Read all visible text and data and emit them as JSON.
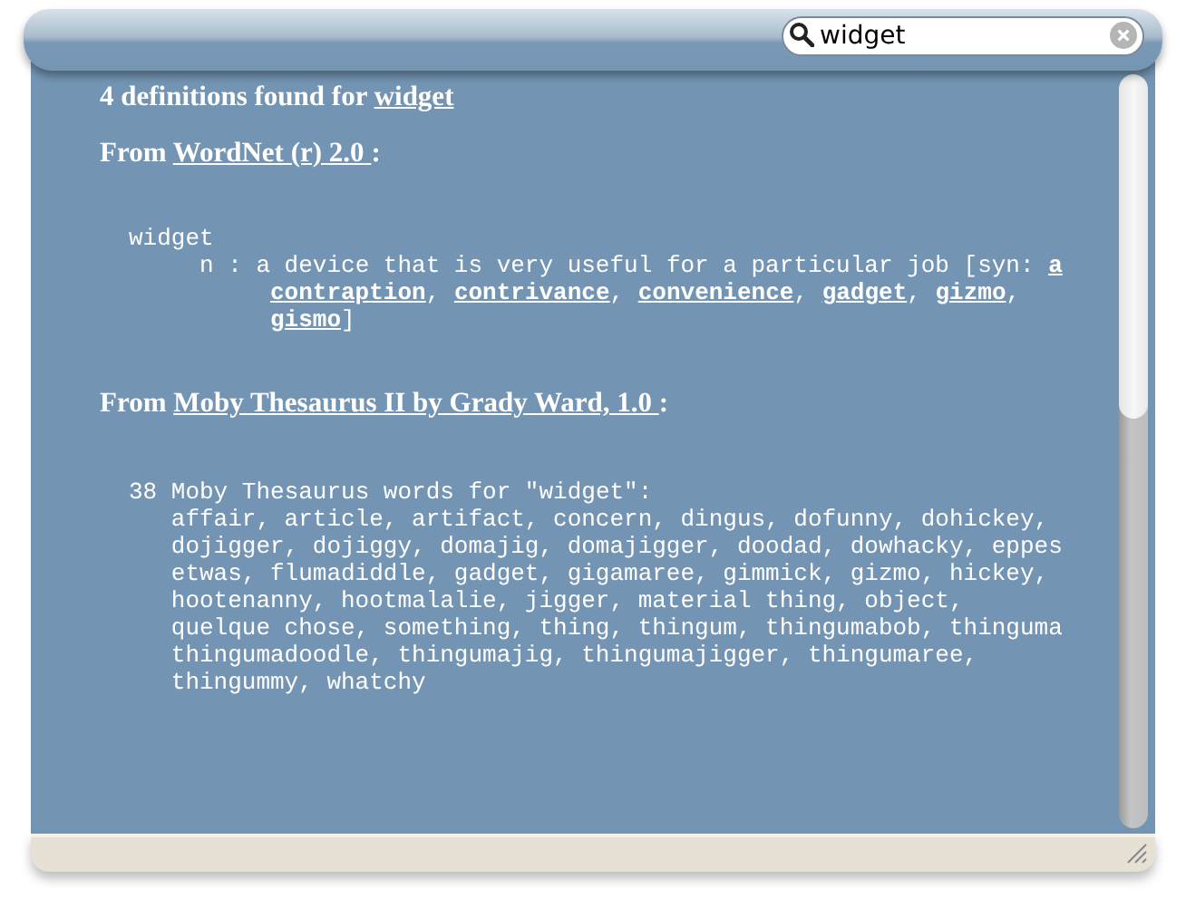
{
  "search": {
    "value": "widget"
  },
  "summary": {
    "text": "4 definitions found for",
    "word": "widget"
  },
  "sources": [
    {
      "prefix": "From",
      "name": "WordNet (r) 2.0",
      "suffix": ":",
      "kind": "wordnet",
      "headword": "widget",
      "sense_lines": [
        [
          {
            "text": "n : a device that is very useful for a particular job [syn: ",
            "link": false
          },
          {
            "text": "a",
            "link": true
          }
        ],
        [
          {
            "text": "contraption",
            "link": true
          },
          {
            "text": ", ",
            "link": false
          },
          {
            "text": "contrivance",
            "link": true
          },
          {
            "text": ", ",
            "link": false
          },
          {
            "text": "convenience",
            "link": true
          },
          {
            "text": ", ",
            "link": false
          },
          {
            "text": "gadget",
            "link": true
          },
          {
            "text": ", ",
            "link": false
          },
          {
            "text": "gizmo",
            "link": true
          },
          {
            "text": ",",
            "link": false
          }
        ],
        [
          {
            "text": "gismo",
            "link": true
          },
          {
            "text": "]",
            "link": false
          }
        ]
      ]
    },
    {
      "prefix": "From",
      "name": "Moby Thesaurus II by Grady Ward, 1.0",
      "suffix": ":",
      "kind": "thesaurus",
      "headword": "38 Moby Thesaurus words for \"widget\":",
      "word_lines": [
        "affair, article, artifact, concern, dingus, dofunny, dohickey,",
        "dojigger, dojiggy, domajig, domajigger, doodad, dowhacky, eppes",
        "etwas, flumadiddle, gadget, gigamaree, gimmick, gizmo, hickey,",
        "hootenanny, hootmalalie, jigger, material thing, object,",
        "quelque chose, something, thing, thingum, thingumabob, thinguma",
        "thingumadoodle, thingumajig, thingumajigger, thingumaree,",
        "thingummy, whatchy"
      ]
    }
  ]
}
